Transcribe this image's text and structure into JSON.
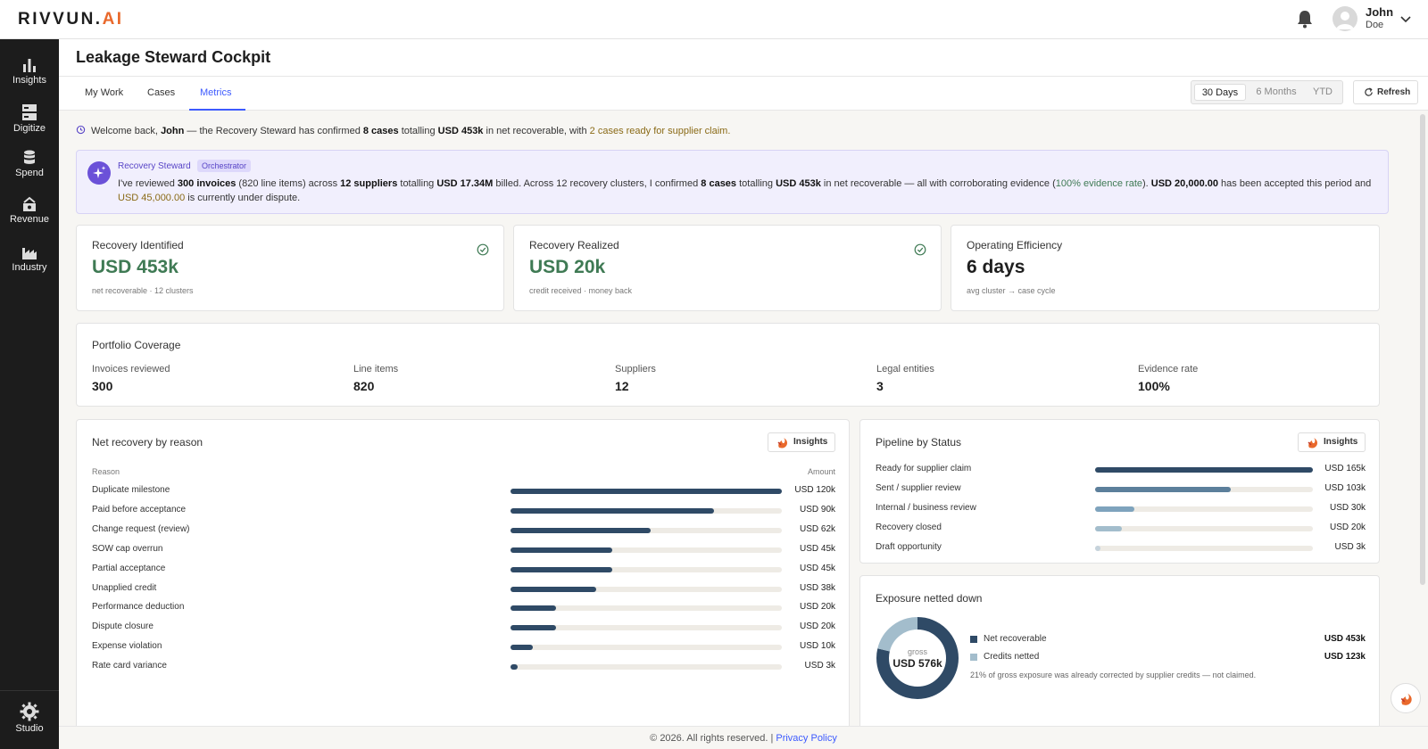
{
  "topbar": {
    "logo_main": "RIVVUN.",
    "logo_accent": "AI",
    "user_first": "John",
    "user_last": "Doe",
    "icons": {
      "notifications": "bell-icon",
      "avatar": "user-avatar-icon",
      "menu": "chevron-down-icon"
    }
  },
  "sidebar": {
    "items": [
      {
        "label": "Insights",
        "icon": "bar-chart-icon"
      },
      {
        "label": "Digitize",
        "icon": "server-stack-icon"
      },
      {
        "label": "Spend",
        "icon": "database-icon"
      },
      {
        "label": "Revenue",
        "icon": "revenue-icon"
      },
      {
        "label": "Industry",
        "icon": "factory-icon"
      }
    ],
    "studio_label": "Studio"
  },
  "header": {
    "title": "Leakage Steward Cockpit"
  },
  "tabs": [
    {
      "label": "My Work",
      "active": false
    },
    {
      "label": "Cases",
      "active": false
    },
    {
      "label": "Metrics",
      "active": true
    }
  ],
  "range": {
    "options": [
      "30 Days",
      "6 Months",
      "YTD"
    ],
    "selected": "30 Days"
  },
  "refresh_label": "Refresh",
  "welcome": {
    "t1": "Welcome back, ",
    "name": "John",
    "t2": " — the Recovery Steward has confirmed ",
    "cases": "8 cases",
    "t3": " totalling ",
    "amount": "USD 453k",
    "t4": " in net recoverable, with ",
    "ready": "2 cases ready for supplier claim.",
    "icon": "history-icon"
  },
  "steward": {
    "name": "Recovery Steward",
    "badge": "Orchestrator",
    "icon": "sparkle-icon",
    "p1": "I've reviewed ",
    "invoices": "300 invoices",
    "p2": " (820 line items) across ",
    "suppliers": "12 suppliers",
    "p3": " totalling ",
    "billed": "USD 17.34M",
    "p4": " billed. Across 12 recovery clusters, I confirmed ",
    "cases": "8 cases",
    "p5": " totalling ",
    "recoverable": "USD 453k",
    "p6": " in net recoverable — all with corroborating evidence (",
    "evidence": "100% evidence rate",
    "p7": "). ",
    "accepted": "USD 20,000.00",
    "p8": " has been accepted this period and ",
    "disputed": "USD 45,000.00",
    "p9": " is currently under dispute."
  },
  "kpis": [
    {
      "label": "Recovery Identified",
      "value": "USD 453k",
      "sub": "net recoverable · 12 clusters",
      "check": true
    },
    {
      "label": "Recovery Realized",
      "value": "USD 20k",
      "sub": "credit received · money back",
      "check": true
    },
    {
      "label": "Operating Efficiency",
      "value": "6 days",
      "sub": "avg cluster → case cycle",
      "check": false
    }
  ],
  "portfolio": {
    "title": "Portfolio Coverage",
    "items": [
      {
        "label": "Invoices reviewed",
        "value": "300"
      },
      {
        "label": "Line items",
        "value": "820"
      },
      {
        "label": "Suppliers",
        "value": "12"
      },
      {
        "label": "Legal entities",
        "value": "3"
      },
      {
        "label": "Evidence rate",
        "value": "100%"
      }
    ]
  },
  "net_recovery": {
    "title": "Net recovery by reason",
    "insights_label": "Insights",
    "col_reason": "Reason",
    "col_amount": "Amount",
    "bar_color": "#2f4a66"
  },
  "pipeline": {
    "title": "Pipeline by Status",
    "insights_label": "Insights"
  },
  "exposure": {
    "title": "Exposure netted down",
    "center_sub": "gross",
    "center_value": "USD 576k",
    "legend": [
      {
        "label": "Net recoverable",
        "value": "USD 453k",
        "color": "#2f4a66"
      },
      {
        "label": "Credits netted",
        "value": "USD 123k",
        "color": "#a3bdcc"
      }
    ],
    "note": "21% of gross exposure was already corrected by supplier credits — not claimed."
  },
  "chart_data": [
    {
      "type": "bar",
      "title": "Net recovery by reason",
      "categories": [
        "Duplicate milestone",
        "Paid before acceptance",
        "Change request (review)",
        "SOW cap overrun",
        "Partial acceptance",
        "Unapplied credit",
        "Performance deduction",
        "Dispute closure",
        "Expense violation",
        "Rate card variance"
      ],
      "values": [
        120,
        90,
        62,
        45,
        45,
        38,
        20,
        20,
        10,
        3
      ],
      "value_labels": [
        "USD 120k",
        "USD 90k",
        "USD 62k",
        "USD 45k",
        "USD 45k",
        "USD 38k",
        "USD 20k",
        "USD 20k",
        "USD 10k",
        "USD 3k"
      ],
      "xlim": [
        0,
        120
      ]
    },
    {
      "type": "bar",
      "title": "Pipeline by Status",
      "categories": [
        "Ready for supplier claim",
        "Sent / supplier review",
        "Internal / business review",
        "Recovery closed",
        "Draft opportunity"
      ],
      "values": [
        165,
        103,
        30,
        20,
        3
      ],
      "value_labels": [
        "USD 165k",
        "USD 103k",
        "USD 30k",
        "USD 20k",
        "USD 3k"
      ],
      "colors": [
        "#2f4a66",
        "#5c7f9b",
        "#7ea3bd",
        "#a3bdcc",
        "#c6d3dc"
      ],
      "xlim": [
        0,
        165
      ]
    },
    {
      "type": "pie",
      "title": "Exposure netted down",
      "categories": [
        "Net recoverable",
        "Credits netted"
      ],
      "values": [
        453,
        123
      ],
      "colors": [
        "#2f4a66",
        "#a3bdcc"
      ]
    }
  ],
  "footer": {
    "text": "© 2026. All rights reserved. | ",
    "link": "Privacy Policy"
  }
}
